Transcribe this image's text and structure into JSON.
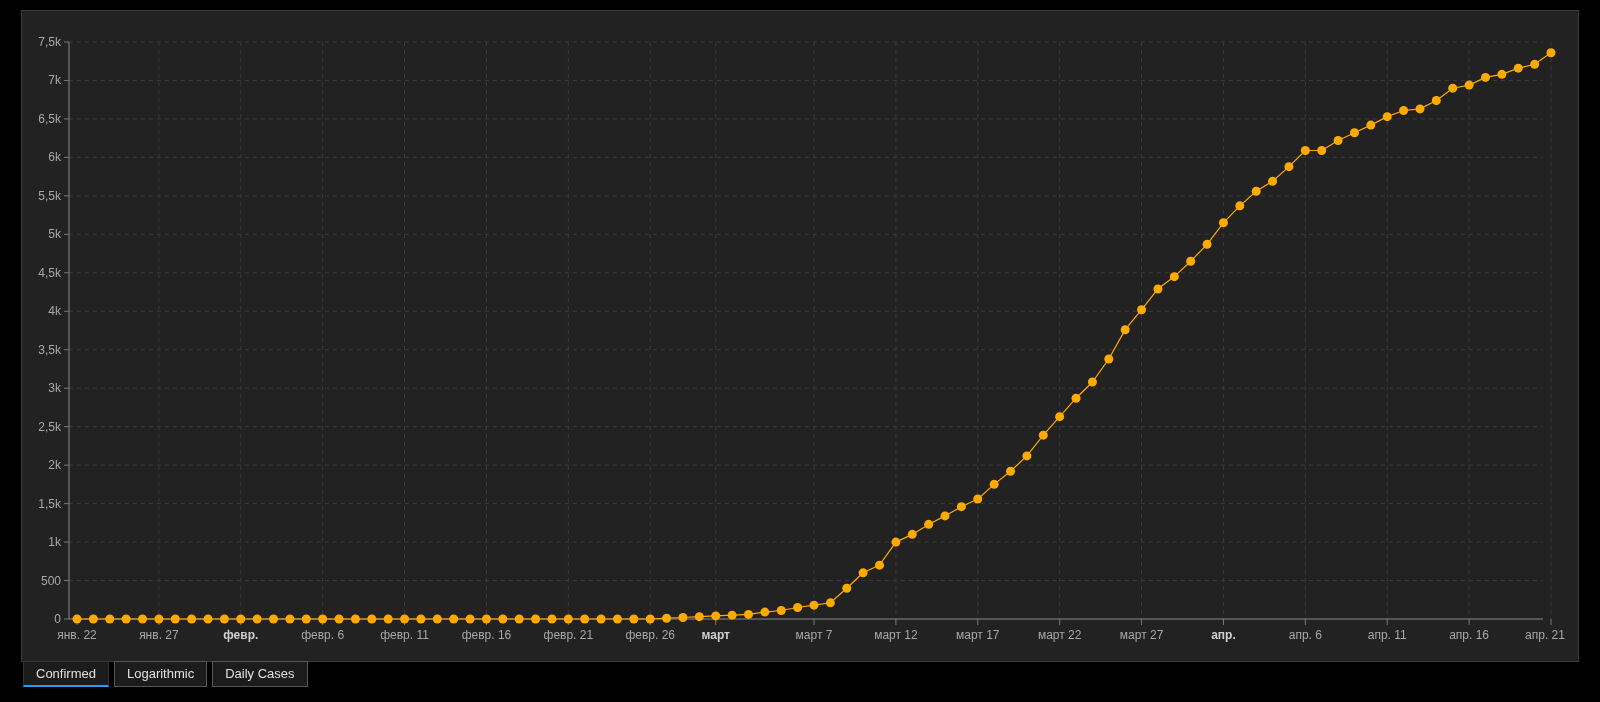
{
  "chart": {
    "chart_data": {
      "type": "line",
      "categories": [
        "янв. 22",
        null,
        null,
        null,
        null,
        "янв. 27",
        null,
        null,
        null,
        null,
        "февр.",
        null,
        null,
        null,
        null,
        "февр. 6",
        null,
        null,
        null,
        null,
        "февр. 11",
        null,
        null,
        null,
        null,
        "февр. 16",
        null,
        null,
        null,
        null,
        "февр. 21",
        null,
        null,
        null,
        null,
        "февр. 26",
        null,
        null,
        null,
        "март",
        null,
        null,
        null,
        null,
        null,
        "март 7",
        null,
        null,
        null,
        null,
        "март 12",
        null,
        null,
        null,
        null,
        "март 17",
        null,
        null,
        null,
        null,
        "март 22",
        null,
        null,
        null,
        null,
        "март 27",
        null,
        null,
        null,
        null,
        "апр.",
        null,
        null,
        null,
        null,
        "апр. 6",
        null,
        null,
        null,
        null,
        "апр. 11",
        null,
        null,
        null,
        null,
        "апр. 16",
        null,
        null,
        null,
        null,
        "апр. 21"
      ],
      "series": [
        {
          "color": "#ffaa00",
          "marker": "circle",
          "values": [
            0,
            0,
            0,
            0,
            0,
            0,
            0,
            0,
            0,
            0,
            0,
            0,
            0,
            0,
            0,
            0,
            0,
            0,
            0,
            0,
            0,
            0,
            0,
            0,
            0,
            0,
            0,
            0,
            0,
            0,
            0,
            0,
            0,
            0,
            0,
            0,
            10,
            20,
            30,
            40,
            50,
            60,
            90,
            110,
            150,
            180,
            210,
            400,
            600,
            700,
            1000,
            1100,
            1230,
            1340,
            1460,
            1560,
            1750,
            1920,
            2120,
            2390,
            2630,
            2870,
            3080,
            3380,
            3760,
            4020,
            4290,
            4450,
            4650,
            4870,
            5150,
            5370,
            5560,
            5690,
            5880,
            6090,
            6090,
            6220,
            6320,
            6420,
            6530,
            6610,
            6630,
            6740,
            6900,
            6940,
            7040,
            7080,
            7160,
            7210,
            7360
          ]
        }
      ],
      "ylim": [
        0,
        7500
      ],
      "grid": true,
      "yticks": [
        {
          "value": 0,
          "label": "0"
        },
        {
          "value": 500,
          "label": "500"
        },
        {
          "value": 1000,
          "label": "1k"
        },
        {
          "value": 1500,
          "label": "1,5k"
        },
        {
          "value": 2000,
          "label": "2k"
        },
        {
          "value": 2500,
          "label": "2,5k"
        },
        {
          "value": 3000,
          "label": "3k"
        },
        {
          "value": 3500,
          "label": "3,5k"
        },
        {
          "value": 4000,
          "label": "4k"
        },
        {
          "value": 4500,
          "label": "4,5k"
        },
        {
          "value": 5000,
          "label": "5k"
        },
        {
          "value": 5500,
          "label": "5,5k"
        },
        {
          "value": 6000,
          "label": "6k"
        },
        {
          "value": 6500,
          "label": "6,5k"
        },
        {
          "value": 7000,
          "label": "7k"
        },
        {
          "value": 7500,
          "label": "7,5k"
        }
      ]
    }
  },
  "tabs": [
    {
      "label": "Confirmed",
      "selected": true
    },
    {
      "label": "Logarithmic",
      "selected": false
    },
    {
      "label": "Daily Cases",
      "selected": false
    }
  ]
}
